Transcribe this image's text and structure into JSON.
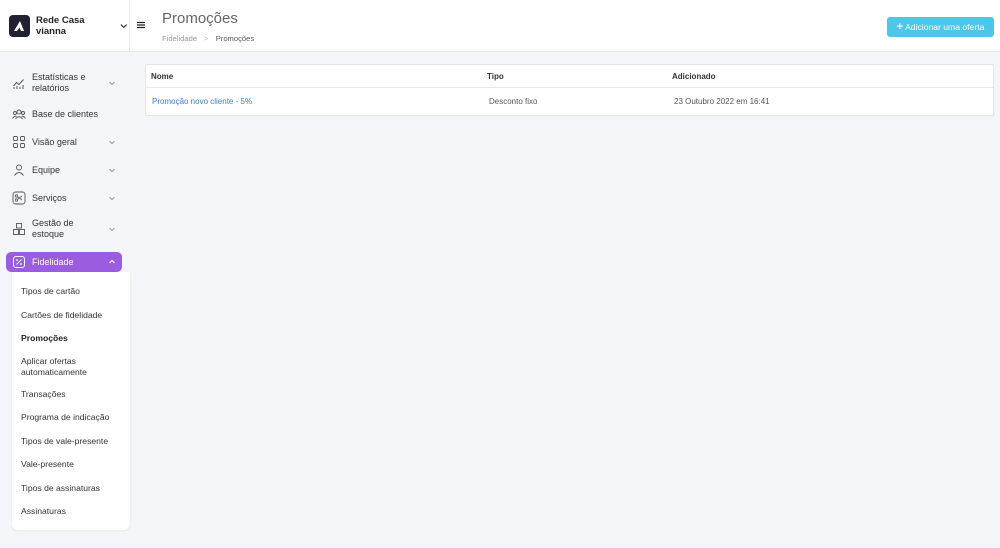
{
  "brand": {
    "name": "Rede Casa vianna"
  },
  "sidebar": {
    "items": [
      {
        "label": "Estatísticas e relatórios",
        "icon": "chart-icon",
        "has_chevron": true
      },
      {
        "label": "Base de clientes",
        "icon": "clients-icon",
        "has_chevron": false
      },
      {
        "label": "Visão geral",
        "icon": "grid-icon",
        "has_chevron": true
      },
      {
        "label": "Equipe",
        "icon": "user-icon",
        "has_chevron": true
      },
      {
        "label": "Serviços",
        "icon": "scissors-icon",
        "has_chevron": true
      },
      {
        "label": "Gestão de estoque",
        "icon": "boxes-icon",
        "has_chevron": true
      },
      {
        "label": "Fidelidade",
        "icon": "loyalty-icon",
        "has_chevron": true,
        "active": true
      }
    ],
    "submenu": [
      {
        "label": "Tipos de cartão"
      },
      {
        "label": "Cartões de fidelidade"
      },
      {
        "label": "Promoções",
        "current": true
      },
      {
        "label": "Aplicar ofertas automaticamente"
      },
      {
        "label": "Transações"
      },
      {
        "label": "Programa de indicação"
      },
      {
        "label": "Tipos de vale-presente"
      },
      {
        "label": "Vale-presente"
      },
      {
        "label": "Tipos de assinaturas"
      },
      {
        "label": "Assinaturas"
      }
    ]
  },
  "header": {
    "title": "Promoções",
    "breadcrumb": {
      "parent": "Fidelidade",
      "separator": ">",
      "current": "Promoções"
    },
    "add_button": "Adicionar uma oferta"
  },
  "table": {
    "columns": [
      "Nome",
      "Tipo",
      "Adicionado"
    ],
    "rows": [
      {
        "name": "Promoção novo cliente - 5%",
        "type": "Desconto fixo",
        "added": "23 Outubro 2022 em 16:41"
      }
    ]
  },
  "colors": {
    "accent": "#9b5de0",
    "button": "#4cc7e8",
    "link": "#3a7fc1",
    "background": "#f4f5f9"
  }
}
